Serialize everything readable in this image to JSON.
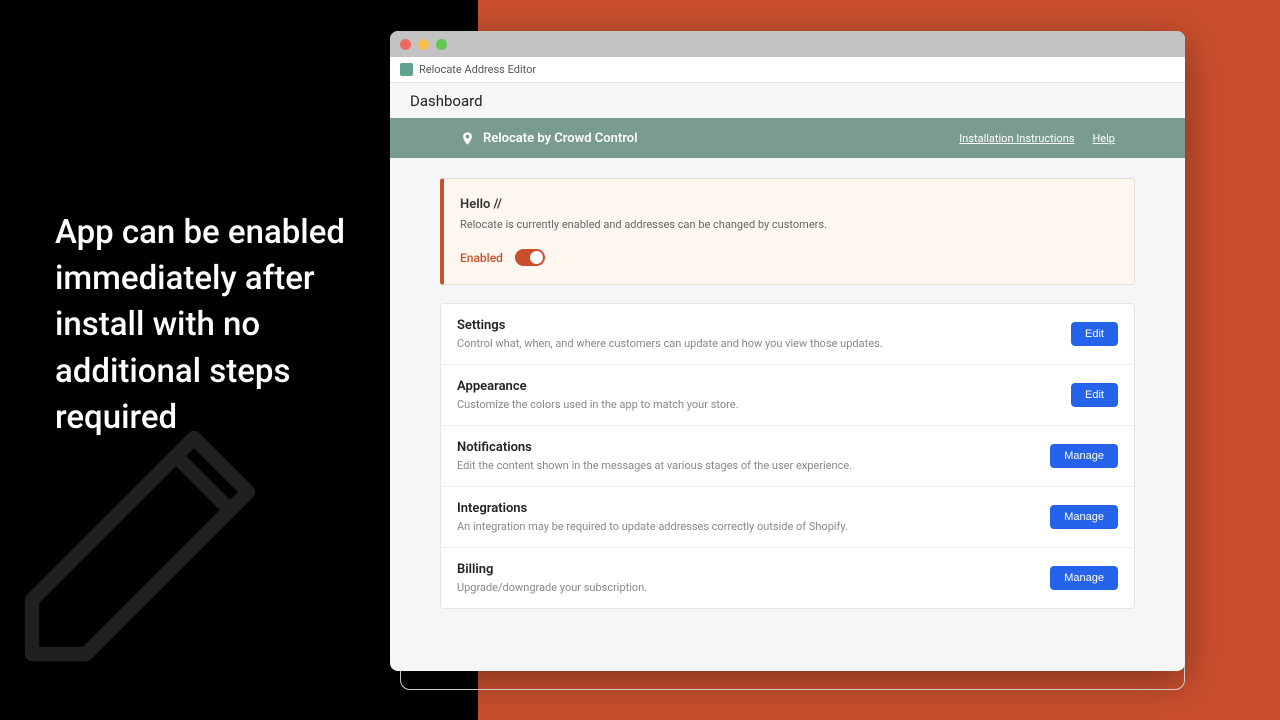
{
  "promo": {
    "text": "App can be enabled immediately after install with no additional steps required"
  },
  "window": {
    "app_name": "Relocate Address Editor",
    "page_title": "Dashboard"
  },
  "greenbar": {
    "title": "Relocate by Crowd Control",
    "links": {
      "instructions": "Installation Instructions",
      "help": "Help"
    }
  },
  "status": {
    "greeting": "Hello //",
    "description": "Relocate is currently enabled and addresses can be changed by customers.",
    "toggle_label": "Enabled"
  },
  "sections": [
    {
      "title": "Settings",
      "desc": "Control what, when, and where customers can update and how you view those updates.",
      "button": "Edit"
    },
    {
      "title": "Appearance",
      "desc": "Customize the colors used in the app to match your store.",
      "button": "Edit"
    },
    {
      "title": "Notifications",
      "desc": "Edit the content shown in the messages at various stages of the user experience.",
      "button": "Manage"
    },
    {
      "title": "Integrations",
      "desc": "An integration may be required to update addresses correctly outside of Shopify.",
      "button": "Manage"
    },
    {
      "title": "Billing",
      "desc": "Upgrade/downgrade your subscription.",
      "button": "Manage"
    }
  ]
}
